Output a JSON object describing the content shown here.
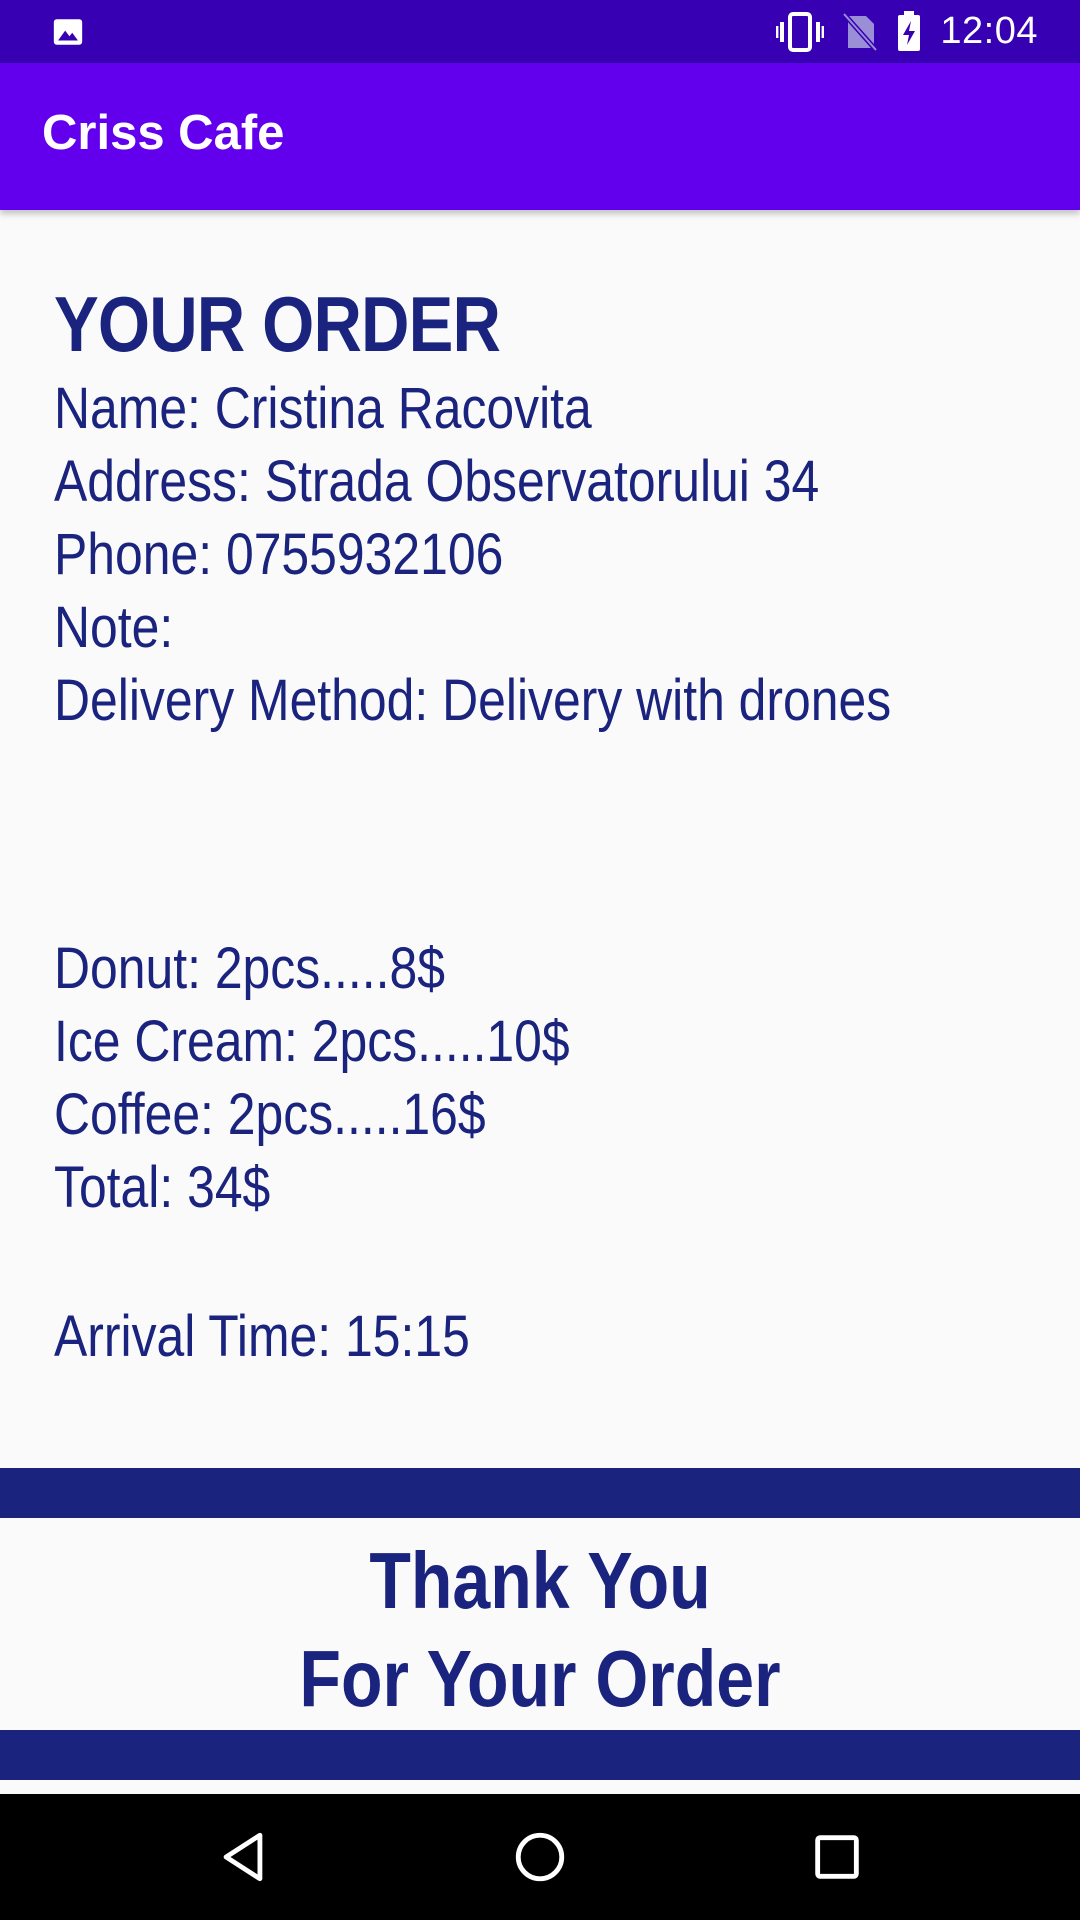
{
  "status_bar": {
    "time": "12:04",
    "icons": [
      "image-icon",
      "vibrate-icon",
      "no-sim-icon",
      "battery-charging-icon"
    ]
  },
  "app_bar": {
    "title": "Criss Cafe"
  },
  "order": {
    "heading": "YOUR ORDER",
    "name": "Name: Cristina Racovita",
    "address": "Address: Strada Observatorului 34",
    "phone": "Phone: 0755932106",
    "note": "Note:",
    "delivery_method": "Delivery Method: Delivery with drones",
    "items": [
      "Donut: 2pcs.....8$",
      "Ice Cream: 2pcs.....10$",
      "Coffee: 2pcs.....16$"
    ],
    "total": "Total: 34$",
    "arrival_time": "Arrival Time: 15:15"
  },
  "thanks": {
    "line1": "Thank You",
    "line2": "For Your Order"
  },
  "colors": {
    "status_bar": "#3700b3",
    "app_bar": "#6200ee",
    "text": "#1a237e",
    "background": "#fafafa"
  },
  "nav_bar": {
    "icons": [
      "back-icon",
      "home-icon",
      "recents-icon"
    ]
  }
}
